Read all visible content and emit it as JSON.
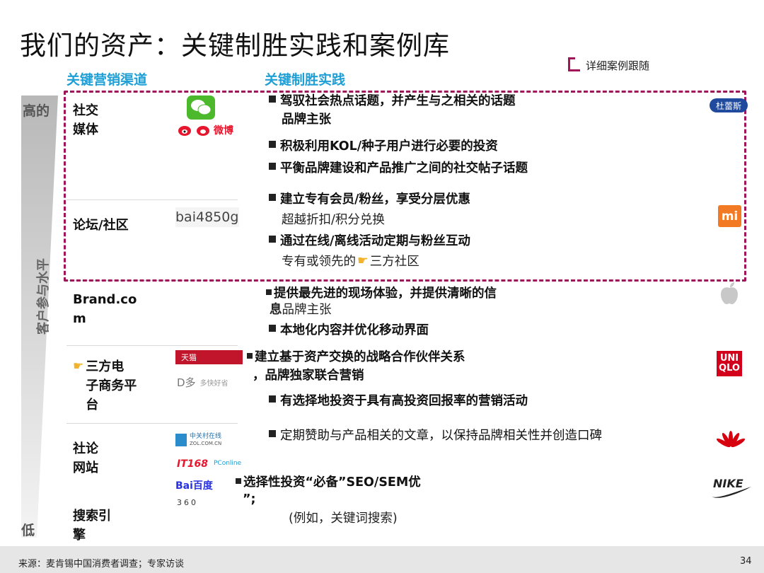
{
  "title": "我们的资产：关键制胜实践和案例库",
  "headers": {
    "channels": "关键营销渠道",
    "practices": "关键制胜实践",
    "tracking": "详细案例跟随"
  },
  "axis": {
    "high": "高的",
    "low": "低",
    "label": "客户参与水平"
  },
  "channels": {
    "social": "社交\n媒体",
    "forum": "论坛/社区",
    "brand": "Brand.co\nm",
    "ecom": "三方电\n子商务平\n台",
    "review": "社论\n网站",
    "search": "搜索引\n擎"
  },
  "channel_logos": {
    "weibo": "微博",
    "forum_handle": "bai4850g",
    "tmall": "天猫",
    "jd": "D多",
    "jd_sub": "多快好省",
    "zol": "中关村在线",
    "zol_sub": "ZOL.COM.CN",
    "it168": "IT168",
    "pconline": "PConline",
    "baidu": "Bai百度",
    "so360": "360"
  },
  "practices": {
    "p1a": "驾驭社会热点话题，并产生与之相关的话题",
    "p1b": "品牌主张",
    "p2": "积极利用KOL/种子用户进行必要的投资",
    "p3": "平衡品牌建设和产品推广之间的社交帖子话题",
    "p4a": "建立专有会员/粉丝，享受分层优惠",
    "p4b": "超越折扣/积分兑换",
    "p5a": "通过在线/离线活动定期与粉丝互动",
    "p5b": "专有或领先的",
    "p5c": "三方社区",
    "p6a": "提供最先进的现场体验，并提供清晰的信",
    "p6b_bold": "息",
    "p6b": "品牌主张",
    "p7": "本地化内容并优化移动界面",
    "p8a": "建立基于资产交换的战略合作伙伴关系",
    "p8b": "，品牌独家联合营销",
    "p9": "有选择地投资于具有高投资回报率的营销活动",
    "p10": "定期赞助与产品相关的文章，以保持品牌相关性并创造口碑",
    "p11a": "选择性投资“必备”SEO/SEM优",
    "p11b": "”;",
    "p11c": "(例如，关键词搜索)"
  },
  "brands": {
    "durex": "杜蕾斯",
    "xiaomi": "mi",
    "uniqlo_top": "UNI",
    "uniqlo_bottom": "QLO",
    "nike": "NIKE"
  },
  "footer": {
    "source": "来源：麦肯锡中国消费者调查；专家访谈",
    "page": "34"
  },
  "colors": {
    "accent": "#a0145a",
    "header_blue": "#1e9fd6",
    "uniqlo": "#d2001a",
    "xiaomi": "#f27a24",
    "huawei": "#d7000f"
  }
}
